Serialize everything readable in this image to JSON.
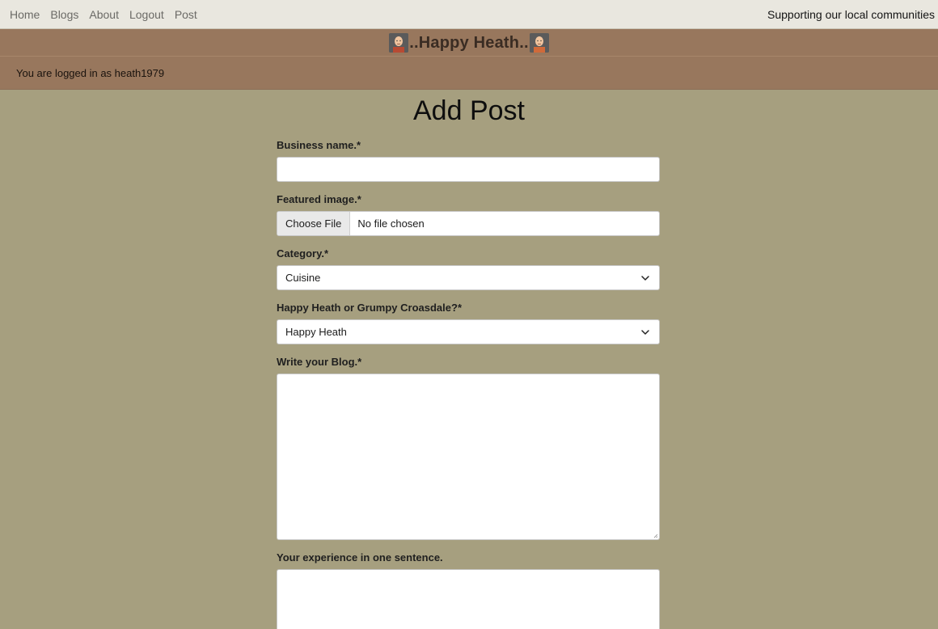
{
  "nav": {
    "links": [
      "Home",
      "Blogs",
      "About",
      "Logout",
      "Post"
    ],
    "tagline": "Supporting our local communities"
  },
  "banner": {
    "title": "..Happy Heath..",
    "logged_in_text": "You are logged in as heath1979"
  },
  "form": {
    "page_title": "Add Post",
    "business_name_label": "Business name.*",
    "business_name_value": "",
    "featured_image_label": "Featured image.*",
    "file_button_label": "Choose File",
    "file_status": "No file chosen",
    "category_label": "Category.*",
    "category_selected": "Cuisine",
    "mood_label": "Happy Heath or Grumpy Croasdale?*",
    "mood_selected": "Happy Heath",
    "blog_label": "Write your Blog.*",
    "blog_value": "",
    "experience_label": "Your experience in one sentence.",
    "experience_value": ""
  },
  "colors": {
    "page_bg": "#a69f7f",
    "topnav_bg": "#e9e7df",
    "banner_bg": "#98775d"
  }
}
